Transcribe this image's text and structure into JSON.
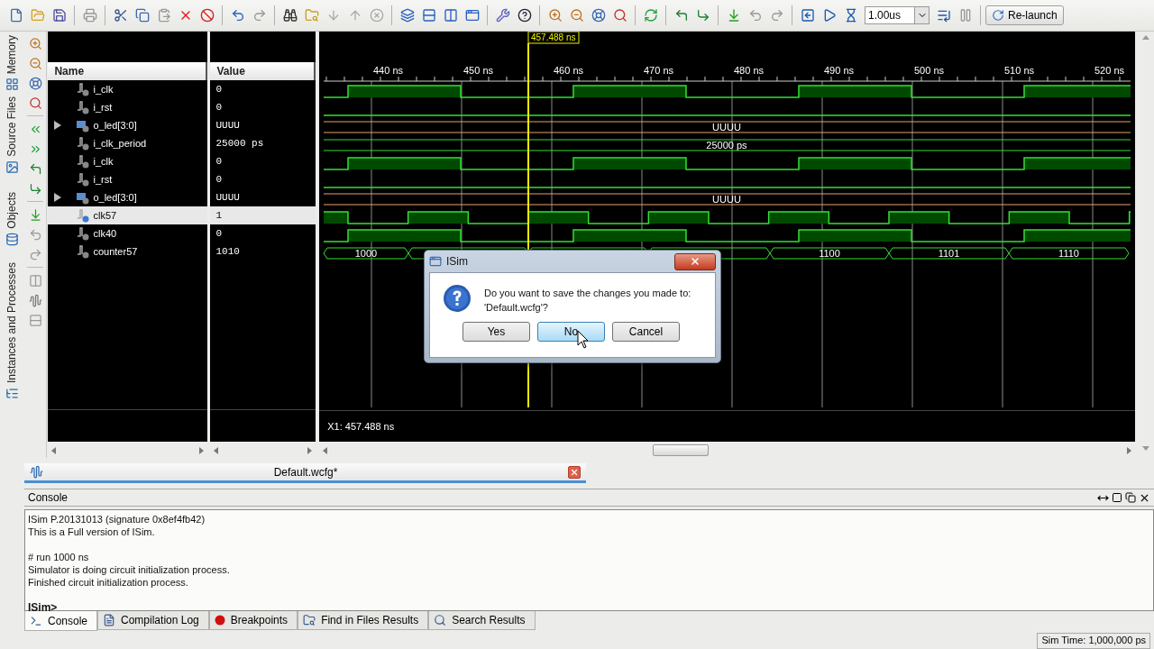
{
  "toolbar": {
    "time_field": {
      "value": "1.00us"
    },
    "relaunch_button": {
      "label": "Re-launch"
    }
  },
  "side_tabs": [
    {
      "label": "Memory"
    },
    {
      "label": "Source Files"
    },
    {
      "label": "Objects"
    },
    {
      "label": "Instances and Processes"
    }
  ],
  "wave_window": {
    "columns": [
      "Name",
      "Value"
    ],
    "signals": [
      {
        "name": "i_clk",
        "value": "0",
        "kind": "clock",
        "selected": false
      },
      {
        "name": "i_rst",
        "value": "0",
        "kind": "low",
        "selected": false
      },
      {
        "name": "o_led[3:0]",
        "value": "UUUU",
        "kind": "bus",
        "expanded": false,
        "selected": false,
        "wave_labels": [
          "UUUU"
        ]
      },
      {
        "name": "i_clk_period",
        "value": "25000 ps",
        "kind": "constant",
        "selected": false,
        "wave_labels": [
          "25000 ps"
        ]
      },
      {
        "name": "i_clk",
        "value": "0",
        "kind": "clock",
        "selected": false
      },
      {
        "name": "i_rst",
        "value": "0",
        "kind": "low",
        "selected": false
      },
      {
        "name": "o_led[3:0]",
        "value": "UUUU",
        "kind": "bus",
        "expanded": false,
        "selected": false,
        "wave_labels": [
          "UUUU"
        ]
      },
      {
        "name": "clk57",
        "value": "1",
        "kind": "fast-clock",
        "selected": true
      },
      {
        "name": "clk40",
        "value": "0",
        "kind": "clock",
        "selected": false
      },
      {
        "name": "counter57",
        "value": "1010",
        "kind": "counter",
        "selected": false,
        "wave_labels": [
          "1000",
          "1100",
          "1101",
          "1110"
        ]
      }
    ],
    "ruler": [
      "440 ns",
      "450 ns",
      "460 ns",
      "470 ns",
      "480 ns",
      "490 ns",
      "500 ns",
      "510 ns",
      "520 ns"
    ],
    "cursor": {
      "label": "457.488 ns"
    },
    "readout": "X1: 457.488 ns"
  },
  "editor_tab": {
    "title": "Default.wcfg*"
  },
  "console": {
    "title": "Console",
    "blocks": [
      [
        "ISim P.20131013 (signature 0x8ef4fb42)",
        "This is a Full version of ISim."
      ],
      [
        "# run 1000 ns",
        "Simulator is doing circuit initialization process.",
        "Finished circuit initialization process."
      ]
    ],
    "prompt": "ISim>"
  },
  "bottom_tabs": [
    {
      "label": "Console",
      "selected": true
    },
    {
      "label": "Compilation Log",
      "selected": false
    },
    {
      "label": "Breakpoints",
      "selected": false
    },
    {
      "label": "Find in Files Results",
      "selected": false
    },
    {
      "label": "Search Results",
      "selected": false
    }
  ],
  "status_bar": {
    "sim_time": "Sim Time: 1,000,000 ps"
  },
  "dialog": {
    "title": "ISim",
    "message": [
      "Do you want to save the changes you made to:",
      "'Default.wcfg'?"
    ],
    "buttons": [
      {
        "label": "Yes",
        "focused": false
      },
      {
        "label": "No",
        "focused": true
      },
      {
        "label": "Cancel",
        "focused": false
      }
    ]
  }
}
